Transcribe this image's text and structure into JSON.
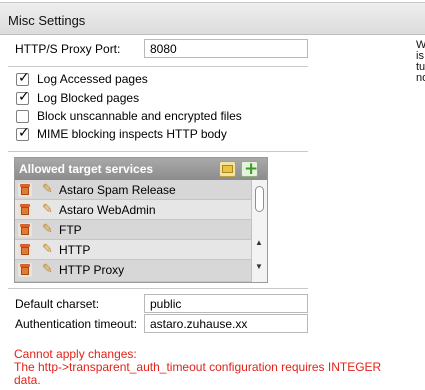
{
  "header": {
    "title": "Misc Settings"
  },
  "side_text": [
    "W",
    "is",
    "tu",
    "no"
  ],
  "proxy_port": {
    "label": "HTTP/S Proxy Port:",
    "value": "8080"
  },
  "checkboxes": [
    {
      "label": "Log Accessed pages",
      "checked": true
    },
    {
      "label": "Log Blocked pages",
      "checked": true
    },
    {
      "label": "Block unscannable and encrypted files",
      "checked": false
    },
    {
      "label": "MIME blocking inspects HTTP body",
      "checked": true
    }
  ],
  "services": {
    "title": "Allowed target services",
    "items": [
      "Astaro Spam Release",
      "Astaro WebAdmin",
      "FTP",
      "HTTP",
      "HTTP Proxy"
    ]
  },
  "charset": {
    "label": "Default charset:",
    "value": "public"
  },
  "auth_timeout": {
    "label": "Authentication timeout:",
    "value": "astaro.zuhause.xx"
  },
  "error": {
    "line1": "Cannot apply changes:",
    "line2": "The http->transparent_auth_timeout configuration requires INTEGER",
    "line3": "data."
  },
  "colors": {
    "error": "#e2231a",
    "list_header": "#9a9a9a"
  }
}
